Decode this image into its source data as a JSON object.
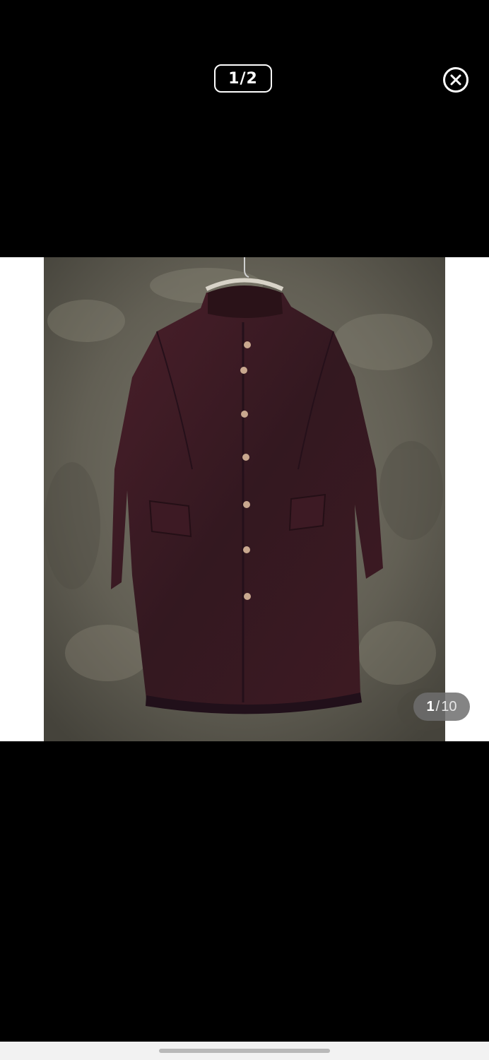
{
  "viewer": {
    "counter_text": "1/2",
    "close_icon": "close-circle-icon"
  },
  "gallery": {
    "current": "1",
    "separator": "/",
    "total": "10"
  },
  "colors": {
    "background": "#000000",
    "frame": "#ffffff",
    "coat": "#3a1a22",
    "wall": "#6d6a5e"
  }
}
